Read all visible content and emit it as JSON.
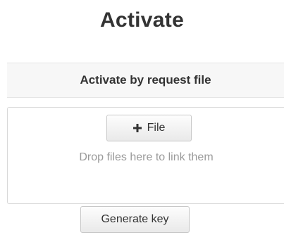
{
  "page": {
    "title": "Activate"
  },
  "request_section": {
    "header": "Activate by request file",
    "file_button_label": "File",
    "file_button_icon": "plus-icon",
    "drop_hint": "Drop files here to link them"
  },
  "actions": {
    "generate_key_label": "Generate key"
  }
}
